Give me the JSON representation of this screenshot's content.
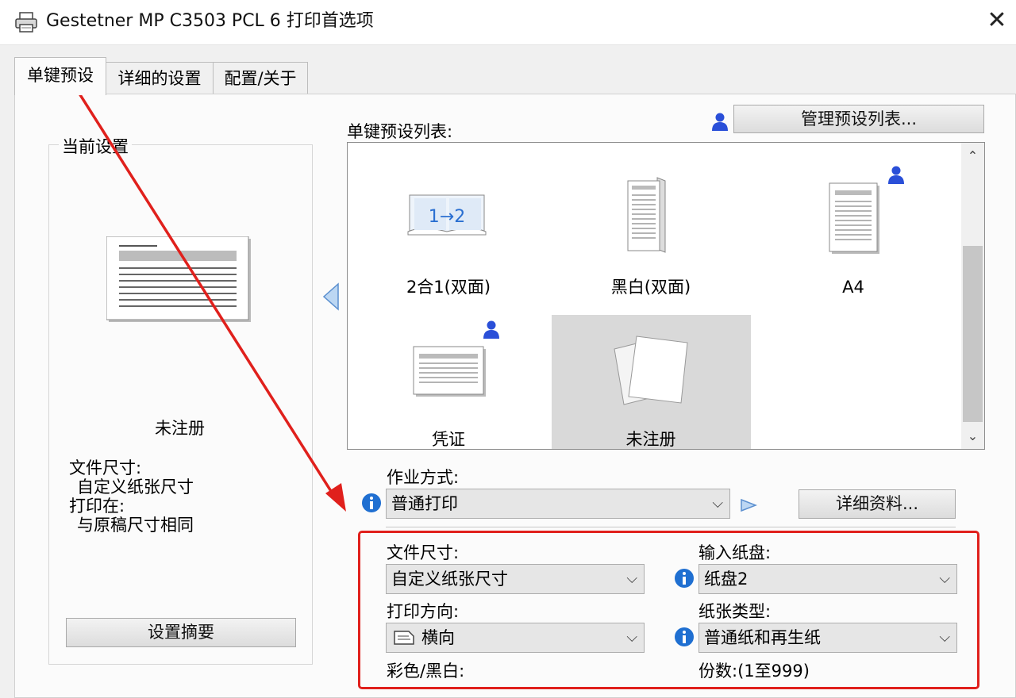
{
  "window": {
    "title": "Gestetner MP C3503 PCL 6 打印首选项",
    "close_icon": "close-icon",
    "app_icon": "printer-icon"
  },
  "tabs": [
    {
      "label": "单键预设",
      "active": true
    },
    {
      "label": "详细的设置",
      "active": false
    },
    {
      "label": "配置/关于",
      "active": false
    }
  ],
  "current_settings": {
    "title": "当前设置",
    "preset_name": "未注册",
    "paper_size_label": "文件尺寸:",
    "paper_size_value": "自定义纸张尺寸",
    "print_on_label": "打印在:",
    "print_on_value": "与原稿尺寸相同",
    "summary_button": "设置摘要"
  },
  "presets": {
    "list_label": "单键预设列表:",
    "manage_button": "管理预设列表...",
    "items": [
      {
        "label": "2合1(双面)",
        "icon": "two-in-one-duplex-icon",
        "selected": false,
        "user": false
      },
      {
        "label": "黑白(双面)",
        "icon": "bw-duplex-icon",
        "selected": false,
        "user": false
      },
      {
        "label": "A4",
        "icon": "a4-page-icon",
        "selected": false,
        "user": true
      },
      {
        "label": "凭证",
        "icon": "voucher-page-icon",
        "selected": false,
        "user": true
      },
      {
        "label": "未注册",
        "icon": "blank-pages-icon",
        "selected": true,
        "user": false
      }
    ],
    "prev_icon": "triangle-left-icon"
  },
  "job": {
    "label": "作业方式:",
    "value": "普通打印",
    "details_button": "详细资料..."
  },
  "form": {
    "doc_size_label": "文件尺寸:",
    "doc_size_value": "自定义纸张尺寸",
    "input_tray_label": "输入纸盘:",
    "input_tray_value": "纸盘2",
    "orientation_label": "打印方向:",
    "orientation_value": "横向",
    "paper_type_label": "纸张类型:",
    "paper_type_value": "普通纸和再生纸",
    "color_label": "彩色/黑白:",
    "copies_label": "份数:(1至999)"
  },
  "colors": {
    "highlight_red": "#e0201c",
    "info_blue": "#1f6fd1",
    "user_blue": "#2a4fd8",
    "arrow_red": "#e0201c"
  }
}
